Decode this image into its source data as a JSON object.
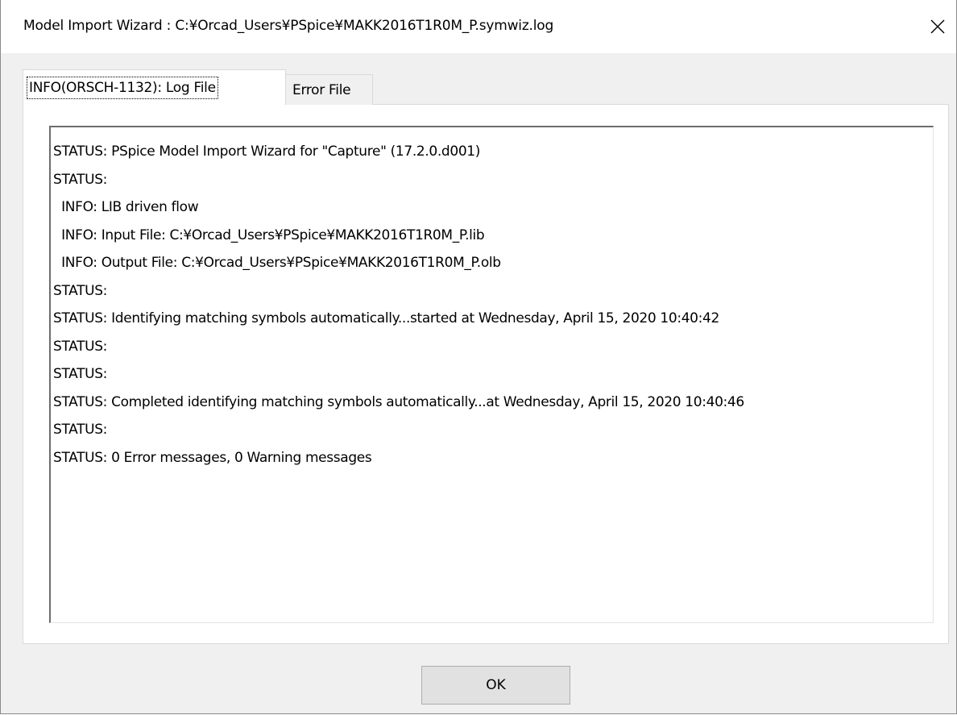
{
  "window": {
    "title": "Model Import Wizard : C:¥Orcad_Users¥PSpice¥MAKK2016T1R0M_P.symwiz.log",
    "close_icon": "close-icon"
  },
  "tabs": [
    {
      "label": "INFO(ORSCH-1132): Log File",
      "selected": true
    },
    {
      "label": "Error File",
      "selected": false
    }
  ],
  "log": {
    "lines": [
      "STATUS: PSpice Model Import Wizard for \"Capture\" (17.2.0.d001)",
      "STATUS:",
      "  INFO: LIB driven flow",
      "  INFO: Input File: C:¥Orcad_Users¥PSpice¥MAKK2016T1R0M_P.lib",
      "  INFO: Output File: C:¥Orcad_Users¥PSpice¥MAKK2016T1R0M_P.olb",
      "STATUS:",
      "STATUS: Identifying matching symbols automatically...started at Wednesday, April 15, 2020 10:40:42",
      "STATUS:",
      "STATUS:",
      "STATUS: Completed identifying matching symbols automatically...at Wednesday, April 15, 2020 10:40:46",
      "STATUS:",
      "STATUS: 0 Error messages, 0 Warning messages"
    ]
  },
  "buttons": {
    "ok_label": "OK"
  }
}
